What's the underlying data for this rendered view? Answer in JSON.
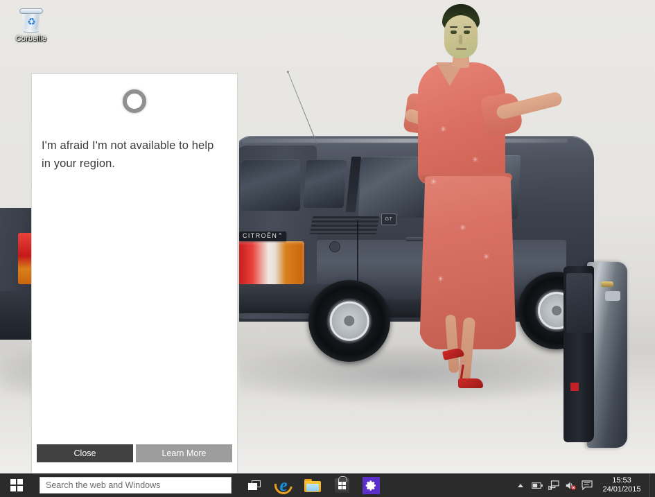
{
  "desktop": {
    "icons": [
      {
        "label": "Corbeille",
        "icon": "recycle-bin-icon"
      }
    ],
    "wallpaper": {
      "description": "Citroen hatchback studio photo with person in coral dress",
      "car_badge": "CITROËN",
      "car_badge_chevron": "⌃",
      "trim_badge": "GT",
      "car_color": "#3c414c",
      "dress_color": "#d9746a",
      "backdrop_color": "#e6e5e1"
    }
  },
  "cortana": {
    "icon": "cortana-ring-icon",
    "message": "I'm afraid I'm not available to help in your region.",
    "buttons": {
      "close": "Close",
      "learn_more": "Learn More"
    },
    "colors": {
      "panel_background": "#ffffff",
      "close_button": "#414141",
      "learn_more_button": "#9d9d9d",
      "text": "#3b3b3b"
    }
  },
  "taskbar": {
    "start": {
      "name": "start-button",
      "icon": "windows-logo-icon"
    },
    "search": {
      "placeholder": "Search the web and Windows",
      "value": ""
    },
    "apps": [
      {
        "name": "task-view",
        "label": "Task View",
        "icon": "task-view-icon"
      },
      {
        "name": "internet-explorer",
        "label": "Internet Explorer",
        "icon": "internet-explorer-icon",
        "glyph": "e"
      },
      {
        "name": "file-explorer",
        "label": "File Explorer",
        "icon": "folder-icon"
      },
      {
        "name": "store",
        "label": "Store",
        "icon": "store-bag-icon"
      },
      {
        "name": "settings",
        "label": "Settings",
        "icon": "gear-icon",
        "color": "#5b2fc9"
      }
    ],
    "tray": [
      {
        "name": "show-hidden-icons",
        "icon": "chevron-up-icon"
      },
      {
        "name": "battery",
        "icon": "battery-icon"
      },
      {
        "name": "network",
        "icon": "network-icon"
      },
      {
        "name": "volume-muted",
        "icon": "speaker-muted-icon"
      },
      {
        "name": "action-center",
        "icon": "action-center-icon"
      }
    ],
    "clock": {
      "time": "15:53",
      "date": "24/01/2015"
    },
    "background": "#2b2b2b"
  }
}
